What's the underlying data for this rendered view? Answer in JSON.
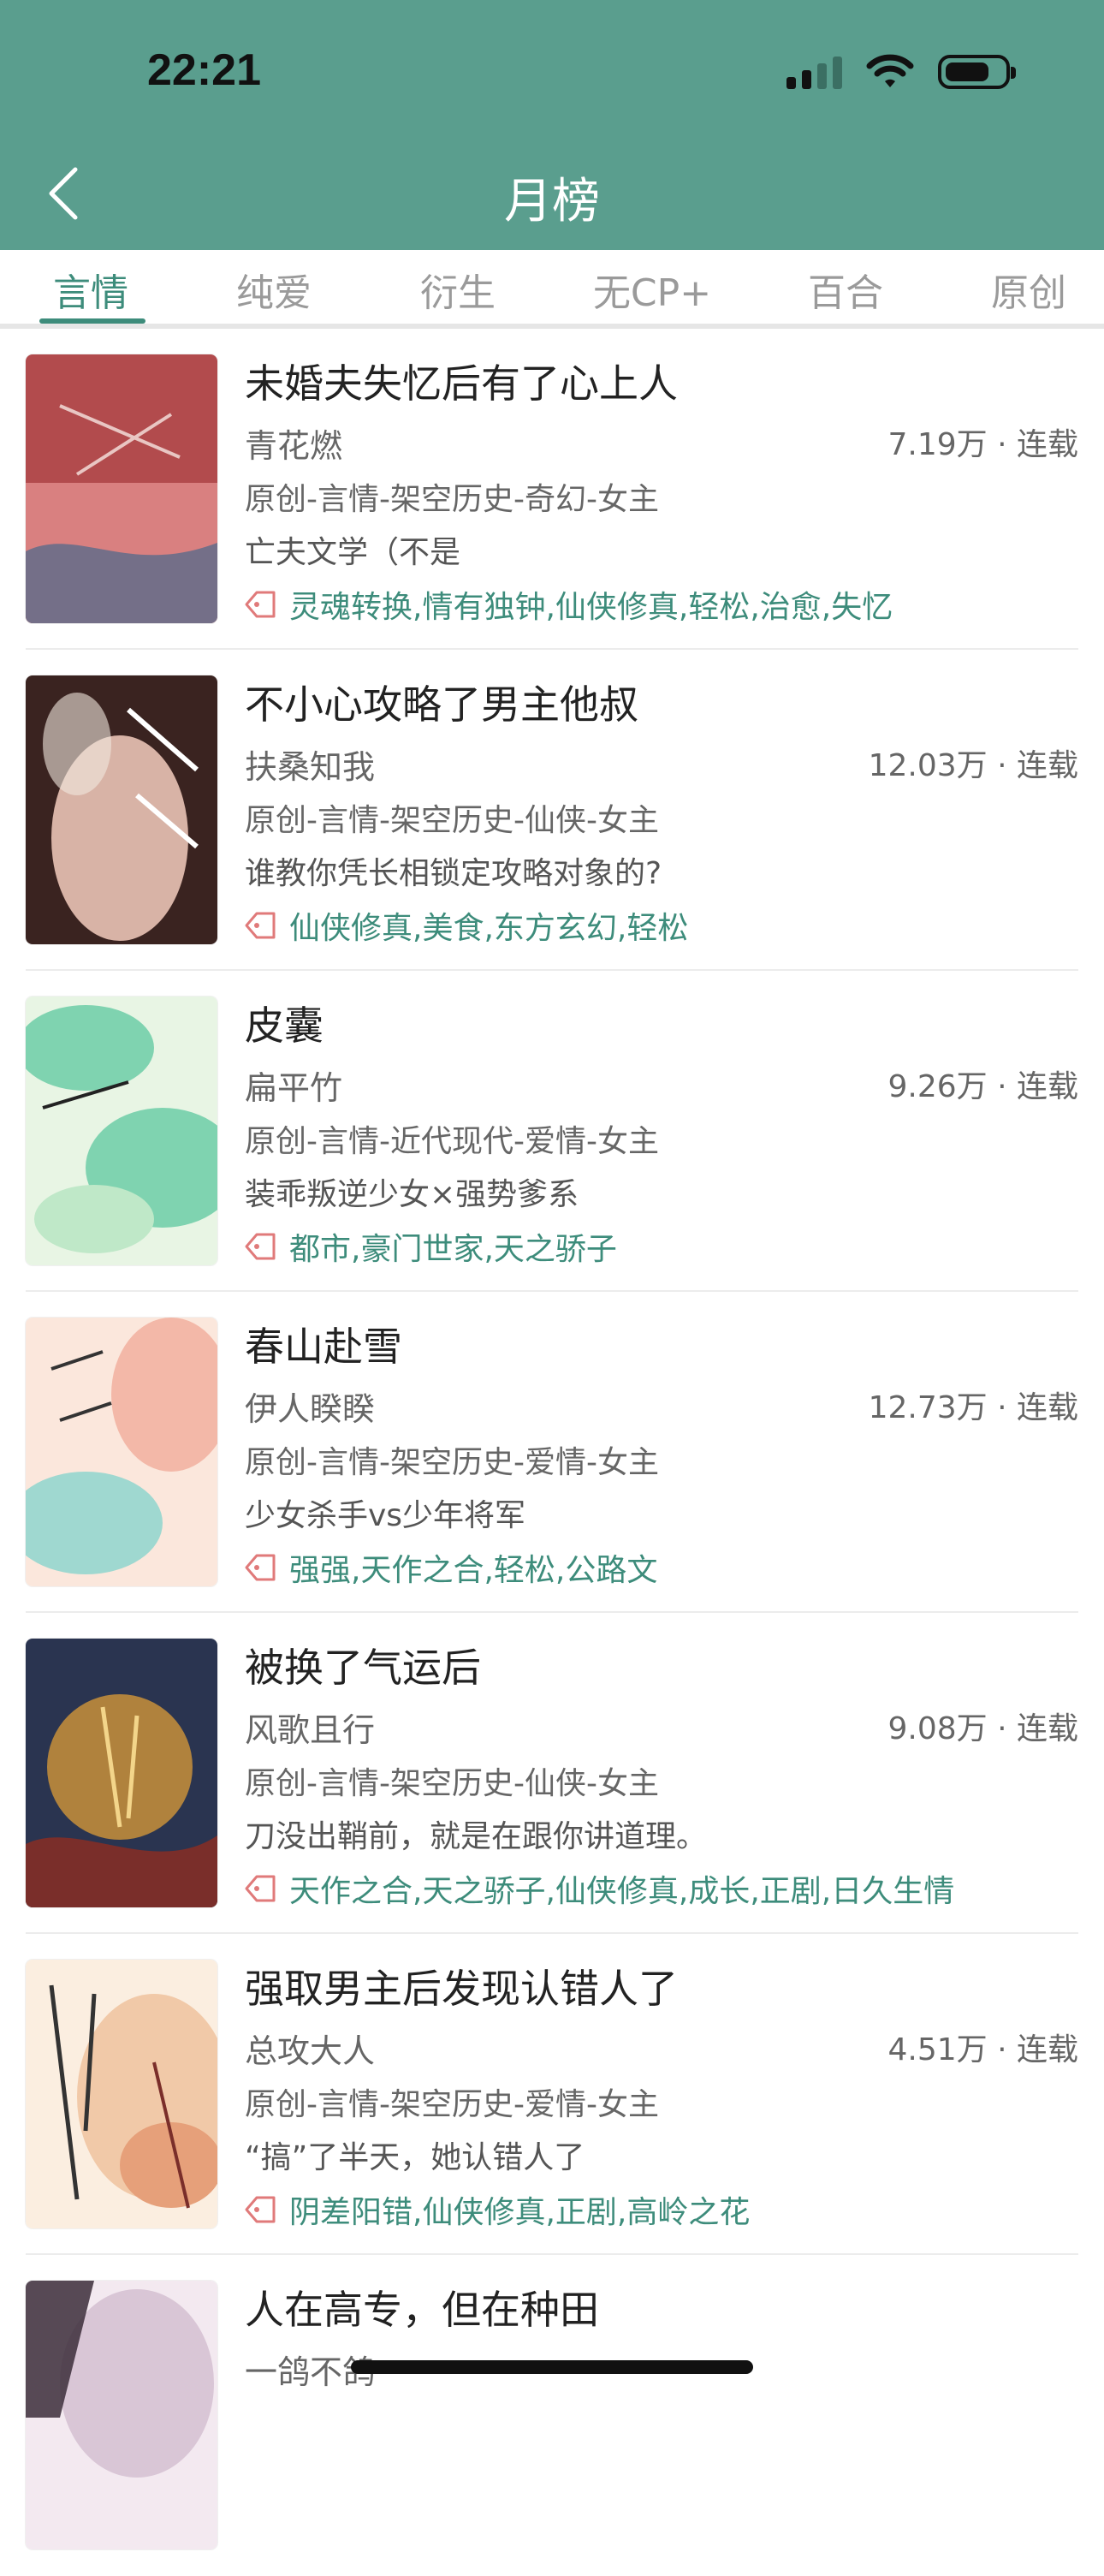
{
  "status_bar": {
    "time": "22:21"
  },
  "nav": {
    "title": "月榜",
    "back_icon": "chevron-left-icon"
  },
  "tabs": [
    {
      "label": "言情",
      "active": true
    },
    {
      "label": "纯爱",
      "active": false
    },
    {
      "label": "衍生",
      "active": false
    },
    {
      "label": "无CP+",
      "active": false
    },
    {
      "label": "百合",
      "active": false
    },
    {
      "label": "原创",
      "active": false
    }
  ],
  "books": [
    {
      "title": "未婚夫失忆后有了心上人",
      "author": "青花燃",
      "stats": "7.19万 · 连载",
      "genre": "原创-言情-架空历史-奇幻-女主",
      "blurb": "亡夫文学（不是",
      "tags": "灵魂转换,情有独钟,仙侠修真,轻松,治愈,失忆",
      "cover_colors": [
        "#b24b4d",
        "#d98080",
        "#e9c6c3"
      ]
    },
    {
      "title": "不小心攻略了男主他叔",
      "author": "扶桑知我",
      "stats": "12.03万 · 连载",
      "genre": "原创-言情-架空历史-仙侠-女主",
      "blurb": "谁教你凭长相锁定攻略对象的?",
      "tags": "仙侠修真,美食,东方玄幻,轻松",
      "cover_colors": [
        "#3a2320",
        "#d8b3a6",
        "#f2e7e0"
      ]
    },
    {
      "title": "皮囊",
      "author": "扁平竹",
      "stats": "9.26万 · 连载",
      "genre": "原创-言情-近代现代-爱情-女主",
      "blurb": "装乖叛逆少女×强势爹系",
      "tags": "都市,豪门世家,天之骄子",
      "cover_colors": [
        "#7fd3b0",
        "#bfe8c8",
        "#e8f5e4"
      ]
    },
    {
      "title": "春山赴雪",
      "author": "伊人睽睽",
      "stats": "12.73万 · 连载",
      "genre": "原创-言情-架空历史-爱情-女主",
      "blurb": "少女杀手vs少年将军",
      "tags": "强强,天作之合,轻松,公路文",
      "cover_colors": [
        "#f3b8a8",
        "#9fd8d0",
        "#fbe7dc"
      ]
    },
    {
      "title": "被换了气运后",
      "author": "风歌且行",
      "stats": "9.08万 · 连载",
      "genre": "原创-言情-架空历史-仙侠-女主",
      "blurb": "刀没出鞘前，就是在跟你讲道理。",
      "tags": "天作之合,天之骄子,仙侠修真,成长,正剧,日久生情",
      "cover_colors": [
        "#2a3450",
        "#c8903a",
        "#7a2e2a"
      ]
    },
    {
      "title": "强取男主后发现认错人了",
      "author": "总攻大人",
      "stats": "4.51万 · 连载",
      "genre": "原创-言情-架空历史-爱情-女主",
      "blurb": "“搞”了半天，她认错人了",
      "tags": "阴差阳错,仙侠修真,正剧,高岭之花",
      "cover_colors": [
        "#f1c9a8",
        "#e6a07a",
        "#fbeee0"
      ]
    },
    {
      "title": "人在高专，但在种田",
      "author": "一鸽不鸽",
      "stats": "",
      "genre": "",
      "blurb": "",
      "tags": "",
      "cover_colors": [
        "#3b2d3a",
        "#d9c6d6",
        "#f3e9f0"
      ]
    }
  ]
}
